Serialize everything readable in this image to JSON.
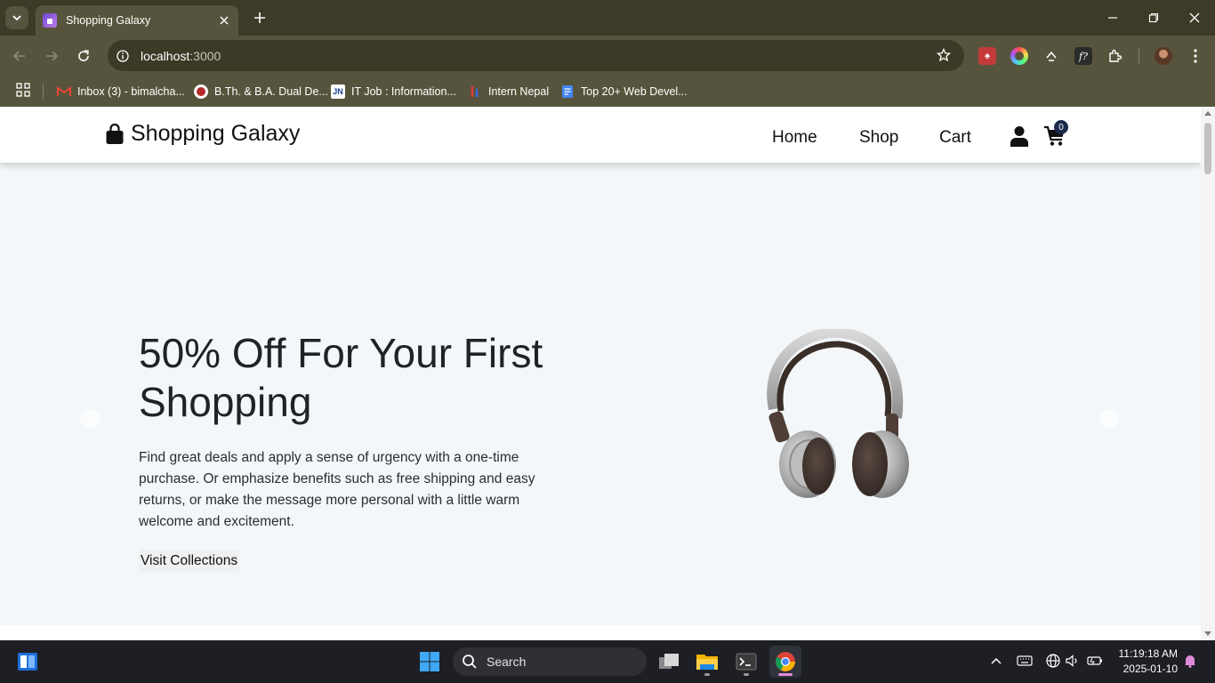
{
  "browser": {
    "tab_title": "Shopping Galaxy",
    "url_host": "localhost",
    "url_port": ":3000",
    "bookmarks": [
      {
        "label": "Inbox (3) - bimalcha...",
        "icon": "gmail-icon"
      },
      {
        "label": "B.Th. & B.A. Dual De...",
        "icon": "university-icon"
      },
      {
        "label": "IT Job : Information...",
        "icon": "jn-icon"
      },
      {
        "label": "Intern Nepal",
        "icon": "intern-nepal-icon"
      },
      {
        "label": "Top 20+ Web Devel...",
        "icon": "docs-icon"
      }
    ]
  },
  "site": {
    "brand": "Shopping Galaxy",
    "nav": [
      {
        "label": "Home"
      },
      {
        "label": "Shop"
      },
      {
        "label": "Cart"
      }
    ],
    "cart_count": "0"
  },
  "hero": {
    "title": "50% Off For Your First Shopping",
    "description": "Find great deals and  apply a sense of urgency with a one-time purchase. Or emphasize benefits such as free shipping and easy returns, or make the message more personal with  a little warm welcome and excitement.",
    "cta": "Visit Collections"
  },
  "taskbar": {
    "search_label": "Search",
    "time": "11:19:18 AM",
    "date": "2025-01-10"
  },
  "colors": {
    "chrome_dark": "#3d3b27",
    "chrome_light": "#57543d",
    "page_bg": "#f4f7f9",
    "badge": "#1b2a4a"
  }
}
